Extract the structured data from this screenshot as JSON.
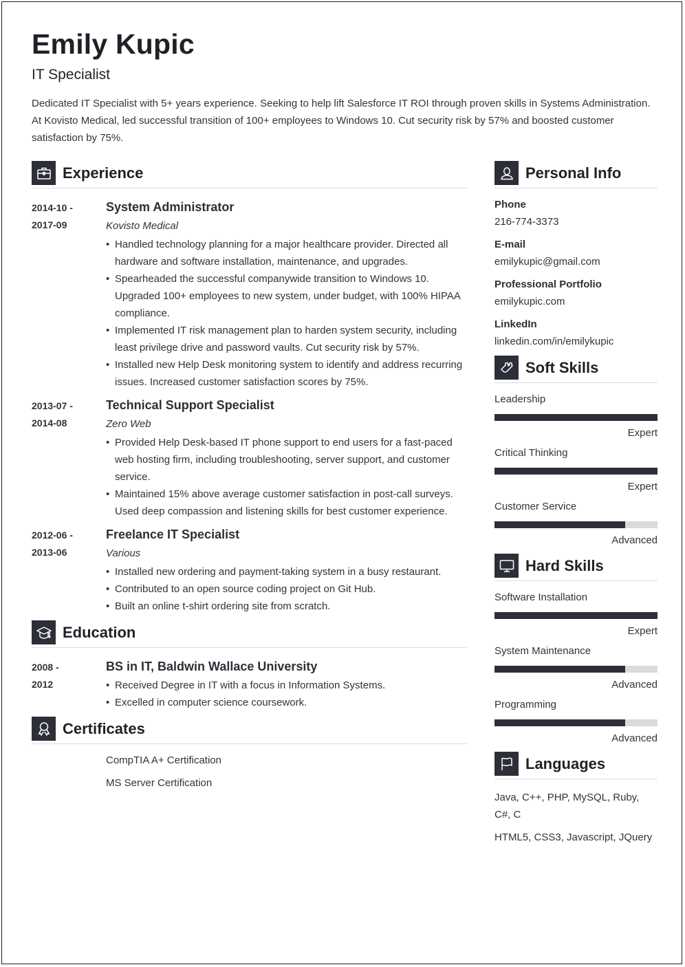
{
  "header": {
    "name": "Emily Kupic",
    "title": "IT Specialist",
    "summary": "Dedicated IT Specialist with 5+ years experience. Seeking to help lift Salesforce IT ROI through proven skills in Systems Administration. At Kovisto Medical, led successful transition of 100+ employees to Windows 10. Cut security risk by 57% and boosted customer satisfaction by 75%."
  },
  "experience": {
    "heading": "Experience",
    "icon": "briefcase-icon",
    "jobs": [
      {
        "date_start": "2014-10 -",
        "date_end": "2017-09",
        "role": "System Administrator",
        "company": "Kovisto Medical",
        "bullets": [
          "Handled technology planning for a major healthcare provider. Directed all hardware and software installation, maintenance, and upgrades.",
          "Spearheaded the successful companywide transition to Windows 10. Upgraded 100+ employees to new system, under budget, with 100% HIPAA compliance.",
          "Implemented IT risk management plan to harden system security, including least privilege drive and password vaults. Cut security risk by 57%.",
          "Installed new Help Desk monitoring system to identify and address recurring issues. Increased customer satisfaction scores by 75%."
        ]
      },
      {
        "date_start": "2013-07 -",
        "date_end": "2014-08",
        "role": "Technical Support Specialist",
        "company": "Zero Web",
        "bullets": [
          "Provided Help Desk-based IT phone support to end users for a fast-paced web hosting firm, including troubleshooting, server support, and customer service.",
          "Maintained 15% above average customer satisfaction in post-call surveys. Used deep compassion and listening skills for best customer experience."
        ]
      },
      {
        "date_start": "2012-06 -",
        "date_end": "2013-06",
        "role": "Freelance IT Specialist",
        "company": "Various",
        "bullets": [
          "Installed new ordering and payment-taking system in a busy restaurant.",
          "Contributed to an open source coding project on Git Hub.",
          "Built an online t-shirt ordering site from scratch."
        ]
      }
    ]
  },
  "education": {
    "heading": "Education",
    "icon": "graduation-cap-icon",
    "items": [
      {
        "date_start": "2008 -",
        "date_end": "2012",
        "degree": "BS in IT, Baldwin Wallace University",
        "bullets": [
          "Received Degree in IT with a focus in Information Systems.",
          "Excelled in computer science coursework."
        ]
      }
    ]
  },
  "certificates": {
    "heading": "Certificates",
    "icon": "award-ribbon-icon",
    "items": [
      "CompTIA A+ Certification",
      "MS Server Certification"
    ]
  },
  "personal_info": {
    "heading": "Personal Info",
    "icon": "user-icon",
    "fields": [
      {
        "label": "Phone",
        "value": "216-774-3373"
      },
      {
        "label": "E-mail",
        "value": "emilykupic@gmail.com"
      },
      {
        "label": "Professional Portfolio",
        "value": "emilykupic.com"
      },
      {
        "label": "LinkedIn",
        "value": "linkedin.com/in/emilykupic"
      }
    ]
  },
  "soft_skills": {
    "heading": "Soft Skills",
    "icon": "puzzle-piece-icon",
    "items": [
      {
        "name": "Leadership",
        "level": "Expert",
        "fill": 1.0
      },
      {
        "name": "Critical Thinking",
        "level": "Expert",
        "fill": 1.0
      },
      {
        "name": "Customer Service",
        "level": "Advanced",
        "fill": 0.8
      }
    ]
  },
  "hard_skills": {
    "heading": "Hard Skills",
    "icon": "monitor-icon",
    "items": [
      {
        "name": "Software Installation",
        "level": "Expert",
        "fill": 1.0
      },
      {
        "name": "System Maintenance",
        "level": "Advanced",
        "fill": 0.8
      },
      {
        "name": "Programming",
        "level": "Advanced",
        "fill": 0.8
      }
    ]
  },
  "languages": {
    "heading": "Languages",
    "icon": "flag-icon",
    "items": [
      "Java, C++, PHP, MySQL, Ruby, C#, C",
      "HTML5, CSS3, Javascript, JQuery"
    ]
  },
  "colors": {
    "accent": "#2c2f38",
    "bar_track": "#d9dadc",
    "text": "#30333a"
  }
}
